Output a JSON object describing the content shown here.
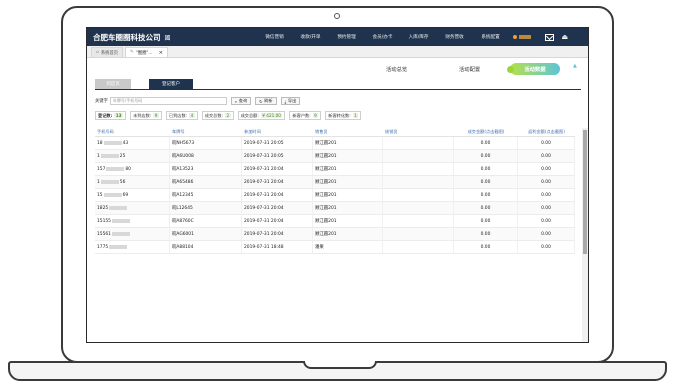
{
  "app": {
    "brand": "合肥车圈圈科技公司",
    "brand_tag": "國",
    "nav": [
      "微信营销",
      "收款/开单",
      "预约管理",
      "会员/办卡",
      "入库/库存",
      "财务营收",
      "系统配置"
    ]
  },
  "tabs": [
    {
      "label": "系统首页",
      "icon": "home-icon"
    },
    {
      "label": "\"圈圈\"...",
      "icon": "pin-icon",
      "close": "×"
    }
  ],
  "activity": {
    "overview": "活动总览",
    "config": "活动配置",
    "data": "活动数据"
  },
  "subtabs": {
    "left": "到店页",
    "right": "登记客户"
  },
  "search": {
    "label": "关键字",
    "placeholder": "车牌号/手机号码",
    "query_btn": "查询",
    "refresh_btn": "刷新",
    "export_btn": "导出"
  },
  "stats": [
    {
      "label": "登记数:",
      "value": "13"
    },
    {
      "label": "未到店数:",
      "value": "9"
    },
    {
      "label": "已到店数:",
      "value": "4"
    },
    {
      "label": "成交总数:",
      "value": "2"
    },
    {
      "label": "成交总额:",
      "value": "¥ 421.00"
    },
    {
      "label": "新客户数:",
      "value": "9"
    },
    {
      "label": "新客转化数:",
      "value": "1"
    }
  ],
  "table": {
    "headers": [
      "手机号码",
      "车牌号",
      "参加时间",
      "销售员",
      "核销员",
      "成交金额(点击截图)",
      "返利金额(点击截图)"
    ],
    "rows": [
      {
        "phone_pre": "18",
        "phone_suf": "43",
        "plate": "皖NH5673",
        "time": "2019-07-31 20:05",
        "sales": "顾江圆201",
        "verifier": "",
        "deal": "0.00",
        "rebate": "0.00"
      },
      {
        "phone_pre": "1",
        "phone_suf": "25",
        "plate": "皖A6U008",
        "time": "2019-07-31 20:05",
        "sales": "顾江圆201",
        "verifier": "",
        "deal": "0.00",
        "rebate": "0.00"
      },
      {
        "phone_pre": "157",
        "phone_suf": "80",
        "plate": "皖A13523",
        "time": "2019-07-31 20:04",
        "sales": "顾江圆201",
        "verifier": "",
        "deal": "0.00",
        "rebate": "0.00"
      },
      {
        "phone_pre": "1",
        "phone_suf": "56",
        "plate": "皖A65486",
        "time": "2019-07-31 20:04",
        "sales": "顾江圆201",
        "verifier": "",
        "deal": "0.00",
        "rebate": "0.00"
      },
      {
        "phone_pre": "15",
        "phone_suf": "69",
        "plate": "皖A12345",
        "time": "2019-07-31 20:04",
        "sales": "顾江圆201",
        "verifier": "",
        "deal": "0.00",
        "rebate": "0.00"
      },
      {
        "phone_pre": "1825",
        "phone_suf": "",
        "plate": "皖L12645",
        "time": "2019-07-31 20:04",
        "sales": "顾江圆201",
        "verifier": "",
        "deal": "0.00",
        "rebate": "0.00"
      },
      {
        "phone_pre": "15155",
        "phone_suf": "",
        "plate": "皖A8760C",
        "time": "2019-07-31 20:04",
        "sales": "顾江圆201",
        "verifier": "",
        "deal": "0.00",
        "rebate": "0.00"
      },
      {
        "phone_pre": "15561",
        "phone_suf": "",
        "plate": "皖AG6001",
        "time": "2019-07-31 20:04",
        "sales": "顾江圆201",
        "verifier": "",
        "deal": "0.00",
        "rebate": "0.00"
      },
      {
        "phone_pre": "1775",
        "phone_suf": "",
        "plate": "皖A88104",
        "time": "2019-07-31 18:48",
        "sales": "潘果",
        "verifier": "",
        "deal": "0.00",
        "rebate": "0.00"
      }
    ]
  },
  "colors": {
    "nav_bg": "#20334e",
    "link_blue": "#3a6eb4",
    "stat_green": "#4a8a2a",
    "pill_from": "#b6e14a",
    "pill_to": "#5cc4d8"
  }
}
